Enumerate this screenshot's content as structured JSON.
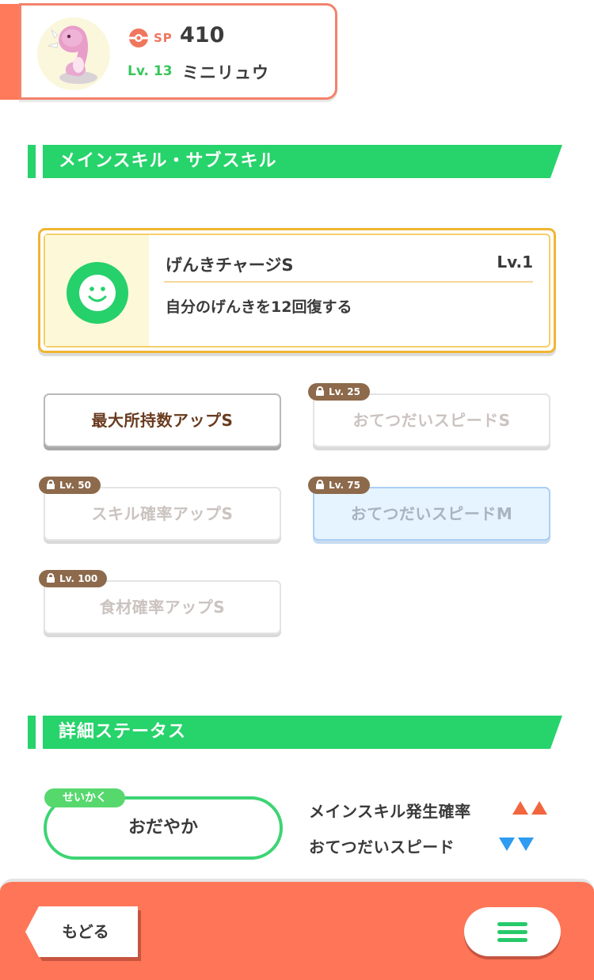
{
  "header": {
    "sp_label": "SP",
    "sp_value": "410",
    "level_label": "Lv. 13",
    "pokemon_name": "ミニリュウ"
  },
  "sections": {
    "skills_title": "メインスキル・サブスキル",
    "details_title": "詳細ステータス"
  },
  "main_skill": {
    "name": "げんきチャージS",
    "level": "Lv.1",
    "description": "自分のげんきを12回復する"
  },
  "sub_skills": [
    {
      "label": "最大所持数アップS",
      "unlocked": true,
      "lock_level": ""
    },
    {
      "label": "おてつだいスピードS",
      "unlocked": false,
      "lock_level": "Lv. 25"
    },
    {
      "label": "スキル確率アップS",
      "unlocked": false,
      "lock_level": "Lv. 50"
    },
    {
      "label": "おてつだいスピードM",
      "unlocked": false,
      "lock_level": "Lv. 75"
    },
    {
      "label": "食材確率アップS",
      "unlocked": false,
      "lock_level": "Lv. 100"
    }
  ],
  "nature": {
    "tag": "せいかく",
    "value": "おだやか",
    "effects": [
      {
        "label": "メインスキル発生確率",
        "direction": "up",
        "strength": 2,
        "color": "#f2663e"
      },
      {
        "label": "おてつだいスピード",
        "direction": "down",
        "strength": 2,
        "color": "#2e9cf0"
      }
    ]
  },
  "footer": {
    "back_label": "もどる",
    "menu_icon": "hamburger-menu-icon"
  },
  "colors": {
    "accent_orange": "#ff7558",
    "section_green": "#27d36b",
    "lock_brown": "#8d6a4c"
  }
}
